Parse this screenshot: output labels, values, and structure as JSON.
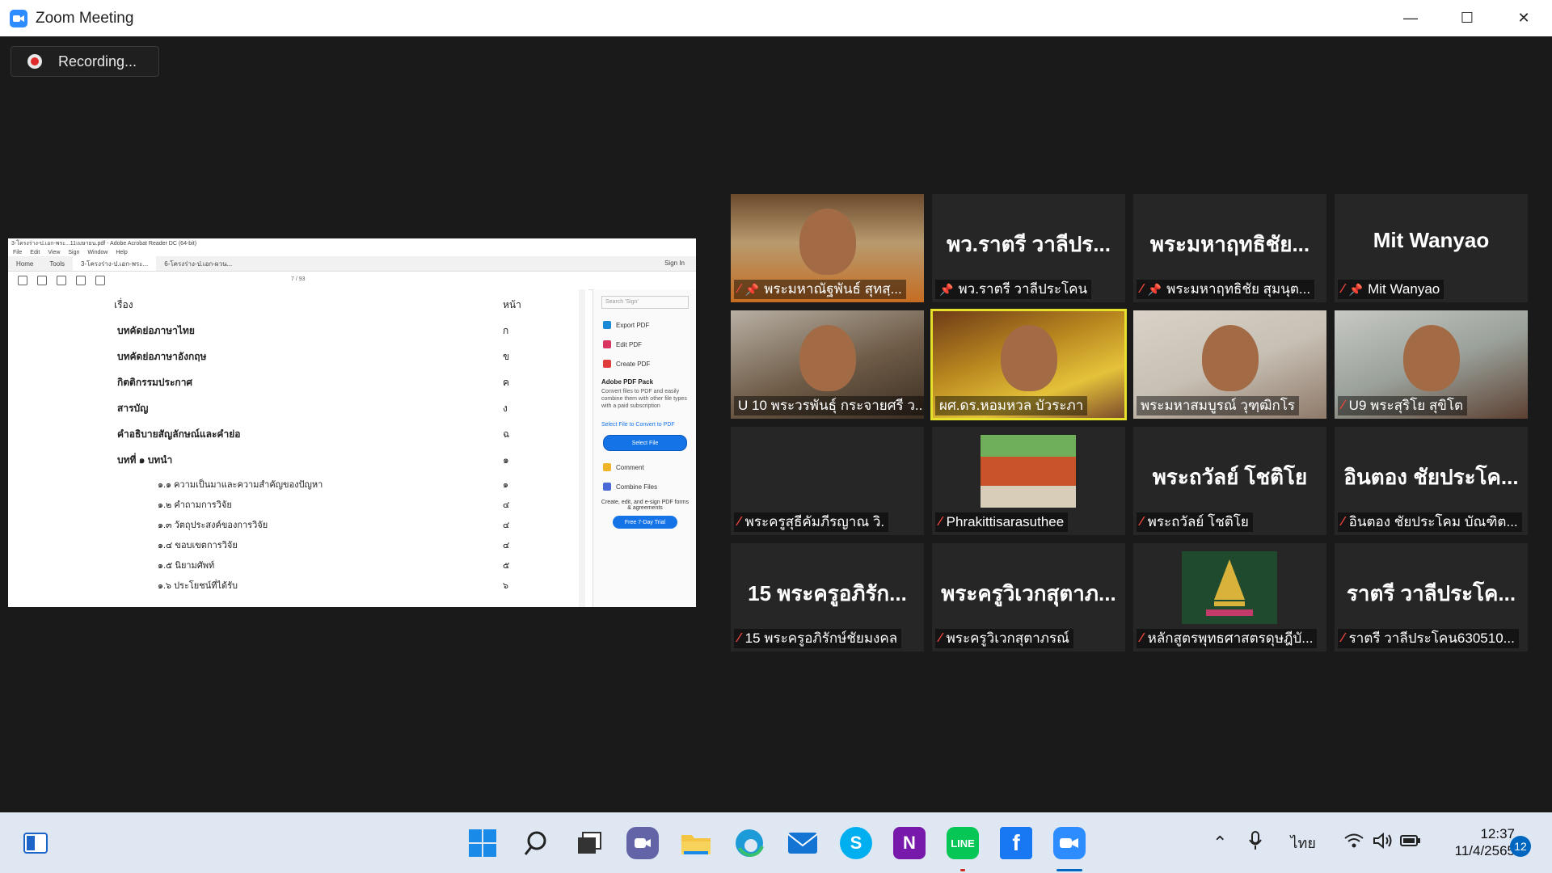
{
  "window": {
    "title": "Zoom Meeting",
    "controls": [
      "—",
      "☐",
      "✕"
    ]
  },
  "recording": {
    "label": "Recording..."
  },
  "shared_screen": {
    "acrobat_title": "3-โครงร่าง-ป.เอก-พระ...11เมษายน.pdf - Adobe Acrobat Reader DC (64-bit)",
    "menu": [
      "File",
      "Edit",
      "View",
      "Sign",
      "Window",
      "Help"
    ],
    "tabs": [
      "Home",
      "Tools",
      "3-โครงร่าง-ป.เอก-พระ...",
      "6-โครงร่าง-ป.เอก-ผวน..."
    ],
    "sign_in": "Sign In",
    "page_indicator": "7 / 93",
    "toc_header": {
      "label": "เรื่อง",
      "page": "หน้า"
    },
    "toc": [
      {
        "label": "บทคัดย่อภาษาไทย",
        "page": "ก",
        "indent": 0
      },
      {
        "label": "บทคัดย่อภาษาอังกฤษ",
        "page": "ข",
        "indent": 0
      },
      {
        "label": "กิตติกรรมประกาศ",
        "page": "ค",
        "indent": 0
      },
      {
        "label": "สารบัญ",
        "page": "ง",
        "indent": 0
      },
      {
        "label": "คำอธิบายสัญลักษณ์และคำย่อ",
        "page": "ฉ",
        "indent": 0
      },
      {
        "label": "บทที่ ๑ บทนำ",
        "page": "๑",
        "indent": 0
      },
      {
        "label": "๑.๑ ความเป็นมาและความสำคัญของปัญหา",
        "page": "๑",
        "indent": 1
      },
      {
        "label": "๑.๒ คำถามการวิจัย",
        "page": "๔",
        "indent": 1
      },
      {
        "label": "๑.๓ วัตถุประสงค์ของการวิจัย",
        "page": "๔",
        "indent": 1
      },
      {
        "label": "๑.๔ ขอบเขตการวิจัย",
        "page": "๔",
        "indent": 1
      },
      {
        "label": "๑.๕ นิยามศัพท์",
        "page": "๕",
        "indent": 1
      },
      {
        "label": "๑.๖ ประโยชน์ที่ได้รับ",
        "page": "๖",
        "indent": 1
      }
    ],
    "side_panel": {
      "search_placeholder": "Search 'Sign'",
      "items": [
        "Export PDF",
        "Edit PDF",
        "Create PDF"
      ],
      "pack_title": "Adobe PDF Pack",
      "pack_text": "Convert files to PDF and easily combine them with other file types with a paid subscription",
      "select_link": "Select File to Convert to PDF",
      "select_button": "Select File",
      "items2": [
        "Comment",
        "Combine Files"
      ],
      "promo": "Create, edit, and e-sign PDF forms & agreements",
      "trial": "Free 7-Day Trial"
    }
  },
  "participants": [
    {
      "big": "",
      "name": "พระมหาณัฐพันธ์ สุทสฺ...",
      "muted": true,
      "pinned": true,
      "video": "vid1"
    },
    {
      "big": "พว.ราตรี วาลีปร...",
      "name": "พว.ราตรี วาลีประโคน",
      "muted": false,
      "pinned": true,
      "video": ""
    },
    {
      "big": "พระมหาฤทธิชัย...",
      "name": "พระมหาฤทธิชัย สุมนุต...",
      "muted": true,
      "pinned": true,
      "video": ""
    },
    {
      "big": "Mit Wanyao",
      "name": "Mit Wanyao",
      "muted": true,
      "pinned": true,
      "video": ""
    },
    {
      "big": "",
      "name": "U 10 พระวรพันธุ์ กระจายศรี ว...",
      "muted": false,
      "pinned": false,
      "video": "vid2"
    },
    {
      "big": "",
      "name": "ผศ.ดร.หอมหวล บัวระภา",
      "muted": false,
      "pinned": false,
      "video": "vid3",
      "active": true
    },
    {
      "big": "",
      "name": "พระมหาสมบูรณ์ วุฑฺฒิกโร",
      "muted": false,
      "pinned": false,
      "video": "vid4"
    },
    {
      "big": "",
      "name": "U9 พระสุริโย สุขิโต",
      "muted": true,
      "pinned": false,
      "video": "vid5"
    },
    {
      "big": "",
      "name": "พระครูสุธีคัมภีรญาณ วิ.",
      "muted": true,
      "pinned": false,
      "video": ""
    },
    {
      "big": "",
      "name": "Phrakittisarasuthee",
      "muted": true,
      "pinned": false,
      "video": "",
      "picture": "sign"
    },
    {
      "big": "พระถวัลย์ โชติโย",
      "name": "พระถวัลย์ โชติโย",
      "muted": true,
      "pinned": false,
      "video": ""
    },
    {
      "big": "อินตอง ชัยประโค...",
      "name": "อินตอง ชัยประโคม บัณฑิต...",
      "muted": true,
      "pinned": false,
      "video": ""
    },
    {
      "big": "15 พระครูอภิรัก...",
      "name": "15 พระครูอภิรักษ์ชัยมงคล",
      "muted": true,
      "pinned": false,
      "video": ""
    },
    {
      "big": "พระครูวิเวกสุตาภ...",
      "name": "พระครูวิเวกสุตาภรณ์",
      "muted": true,
      "pinned": false,
      "video": ""
    },
    {
      "big": "",
      "name": "หลักสูตรพุทธศาสตรดุษฎีบั...",
      "muted": true,
      "pinned": false,
      "video": "",
      "picture": "logo"
    },
    {
      "big": "ราตรี วาลีประโค...",
      "name": "ราตรี วาลีประโคน630510...",
      "muted": true,
      "pinned": false,
      "video": ""
    }
  ],
  "taskbar": {
    "apps": [
      "windows-logo-icon",
      "search-icon",
      "task-view-icon",
      "chat-icon",
      "file-explorer-icon",
      "edge-icon",
      "mail-icon",
      "skype-icon",
      "onenote-icon",
      "line-icon",
      "facebook-icon",
      "zoom-icon"
    ],
    "language": "ไทย",
    "time": "12:37",
    "date": "11/4/2565",
    "notifications": "12"
  },
  "colors": {
    "zoom_blue": "#2d8cff",
    "active_speaker": "#e5e12a",
    "muted_red": "#e8453c"
  }
}
